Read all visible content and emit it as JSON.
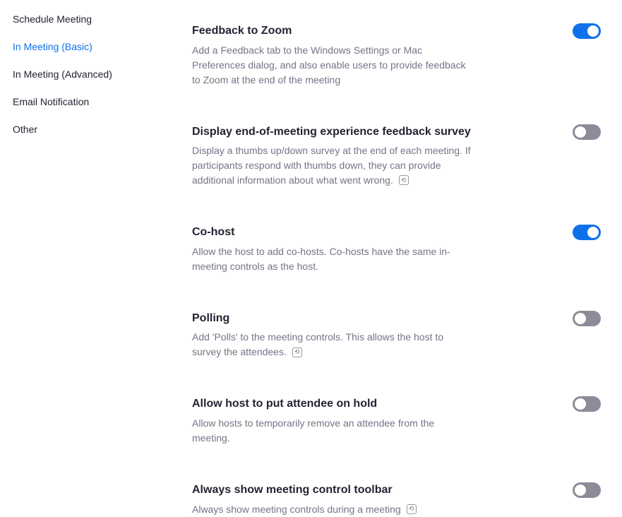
{
  "sidebar": {
    "items": [
      {
        "label": "Schedule Meeting",
        "active": false
      },
      {
        "label": "In Meeting (Basic)",
        "active": true
      },
      {
        "label": "In Meeting (Advanced)",
        "active": false
      },
      {
        "label": "Email Notification",
        "active": false
      },
      {
        "label": "Other",
        "active": false
      }
    ]
  },
  "settings": [
    {
      "title": "Feedback to Zoom",
      "desc": "Add a Feedback tab to the Windows Settings or Mac Preferences dialog, and also enable users to provide feedback to Zoom at the end of the meeting",
      "enabled": true,
      "has_reset": false
    },
    {
      "title": "Display end-of-meeting experience feedback survey",
      "desc": "Display a thumbs up/down survey at the end of each meeting. If participants respond with thumbs down, they can provide additional information about what went wrong.",
      "enabled": false,
      "has_reset": true
    },
    {
      "title": "Co-host",
      "desc": "Allow the host to add co-hosts. Co-hosts have the same in-meeting controls as the host.",
      "enabled": true,
      "has_reset": false
    },
    {
      "title": "Polling",
      "desc": "Add 'Polls' to the meeting controls. This allows the host to survey the attendees.",
      "enabled": false,
      "has_reset": true
    },
    {
      "title": "Allow host to put attendee on hold",
      "desc": "Allow hosts to temporarily remove an attendee from the meeting.",
      "enabled": false,
      "has_reset": false
    },
    {
      "title": "Always show meeting control toolbar",
      "desc": "Always show meeting controls during a meeting",
      "enabled": false,
      "has_reset": true
    }
  ],
  "reset_glyph": "⟲"
}
